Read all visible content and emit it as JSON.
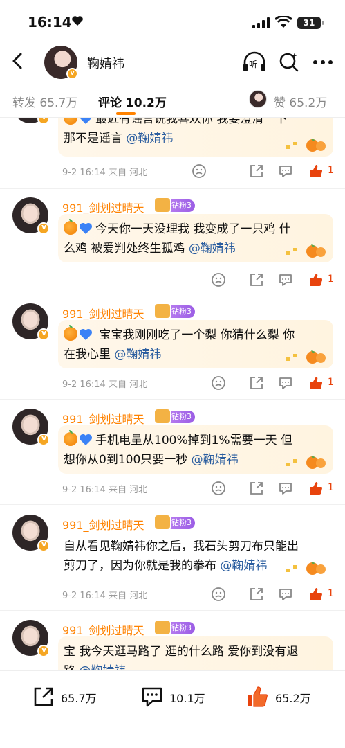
{
  "status_bar": {
    "time": "16:14",
    "battery": "31"
  },
  "header": {
    "title": "鞠婧祎",
    "listen_label": "听"
  },
  "tabs": {
    "repost_label": "转发",
    "repost_count": "65.7万",
    "comment_label": "评论",
    "comment_count": "10.2万",
    "like_label": "赞",
    "like_count": "65.2万"
  },
  "comments": [
    {
      "text": "最近有谣言说我喜欢你 我要澄清一下 那不是谣言",
      "line1": "最近有谣言说我喜欢你 我要澄清一下",
      "line2": "那不是谣言",
      "mention": "@鞠婧祎",
      "time": "9-2 16:14",
      "source": "来自 河北",
      "likes": "1"
    },
    {
      "user": "991_剑划过晴天",
      "fan_badge": "钻粉3",
      "line1": "今天你一天没理我 我变成了一只鸡 什",
      "line2": "么鸡 被爱判处终生孤鸡",
      "mention": "@鞠婧祎",
      "likes": "1"
    },
    {
      "user": "991_剑划过晴天",
      "fan_badge": "钻粉3",
      "line1": " 宝宝我刚刚吃了一个梨 你猜什么梨 你",
      "line2": "在我心里",
      "mention": "@鞠婧祎",
      "time": "9-2 16:14",
      "source": "来自 河北",
      "likes": "1"
    },
    {
      "user": "991_剑划过晴天",
      "fan_badge": "钻粉3",
      "line1": "手机电量从100%掉到1%需要一天 但",
      "line2": "想你从0到100只要一秒",
      "mention": "@鞠婧祎",
      "time": "9-2 16:14",
      "source": "来自 河北",
      "likes": "1"
    },
    {
      "user": "991_剑划过晴天",
      "fan_badge": "钻粉3",
      "line1": "自从看见鞠婧祎你之后，我石头剪刀布只能出",
      "line2": "剪刀了，因为你就是我的拳布",
      "mention": "@鞠婧祎",
      "time": "9-2 16:14",
      "source": "来自 河北",
      "likes": "1"
    },
    {
      "user": "991_剑划过晴天",
      "fan_badge": "钻粉3",
      "line1": "宝 我今天逛马路了 逛的什么路 爱你到没有退",
      "line2": "路",
      "mention": "@鞠婧祎"
    }
  ],
  "bottom_bar": {
    "repost": "65.7万",
    "comment": "10.1万",
    "like": "65.2万"
  },
  "icons": [
    "heart-icon",
    "signal-icon",
    "wifi-icon",
    "back-icon",
    "headphones-icon",
    "search-icon",
    "more-icon",
    "dislike-icon",
    "share-icon",
    "comment-icon",
    "like-icon"
  ],
  "colors": {
    "accent": "#ff8200",
    "mention": "#2a5d9f",
    "like": "#e8430d",
    "bubble": "#fff6e6"
  }
}
